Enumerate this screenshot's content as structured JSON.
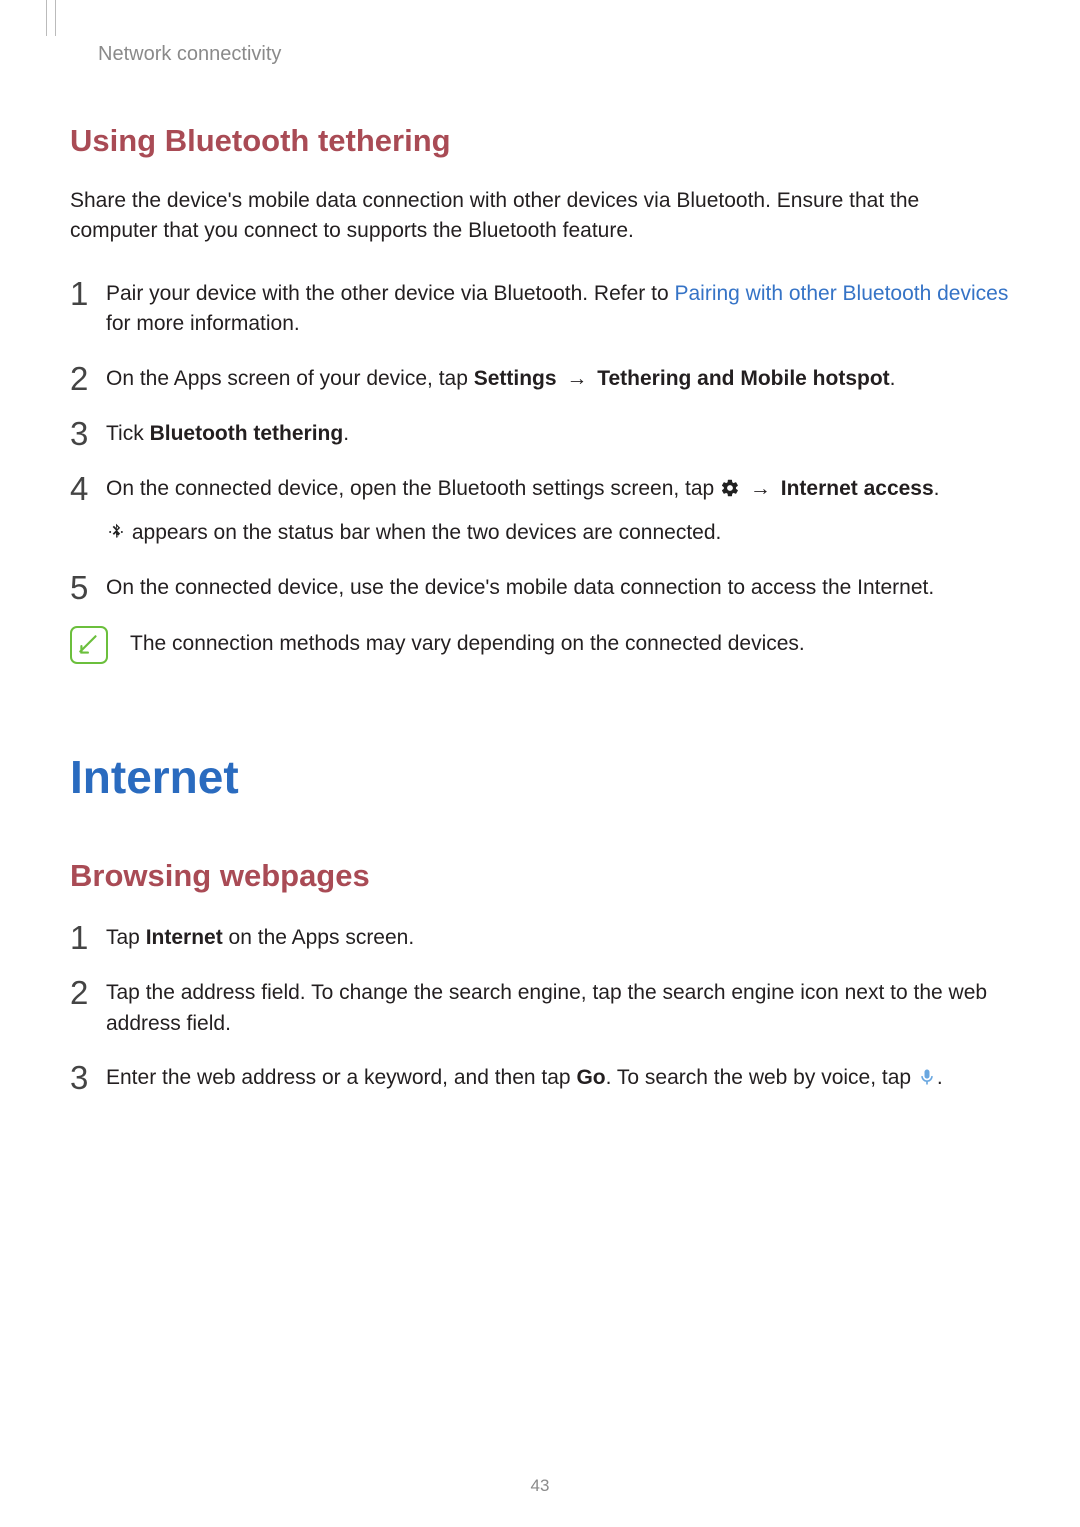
{
  "breadcrumb": "Network connectivity",
  "page_number": "43",
  "section1": {
    "heading": "Using Bluetooth tethering",
    "intro": "Share the device's mobile data connection with other devices via Bluetooth. Ensure that the computer that you connect to supports the Bluetooth feature.",
    "steps": {
      "s1": {
        "num": "1",
        "t1": "Pair your device with the other device via Bluetooth. Refer to ",
        "link": "Pairing with other Bluetooth devices",
        "t2": " for more information."
      },
      "s2": {
        "num": "2",
        "t1": "On the Apps screen of your device, tap ",
        "b1": "Settings",
        "arrow": " → ",
        "b2": "Tethering and Mobile hotspot",
        "t2": "."
      },
      "s3": {
        "num": "3",
        "t1": "Tick ",
        "b1": "Bluetooth tethering",
        "t2": "."
      },
      "s4": {
        "num": "4",
        "t1": "On the connected device, open the Bluetooth settings screen, tap ",
        "arrow": " → ",
        "b1": "Internet access",
        "t2": ".",
        "sub1": " appears on the status bar when the two devices are connected."
      },
      "s5": {
        "num": "5",
        "t1": "On the connected device, use the device's mobile data connection to access the Internet."
      }
    },
    "note": "The connection methods may vary depending on the connected devices."
  },
  "section2": {
    "heading": "Internet",
    "sub_heading": "Browsing webpages",
    "steps": {
      "s1": {
        "num": "1",
        "t1": "Tap ",
        "b1": "Internet",
        "t2": " on the Apps screen."
      },
      "s2": {
        "num": "2",
        "t1": "Tap the address field. To change the search engine, tap the search engine icon next to the web address field."
      },
      "s3": {
        "num": "3",
        "t1": "Enter the web address or a keyword, and then tap ",
        "b1": "Go",
        "t2": ". To search the web by voice, tap ",
        "t3": "."
      }
    }
  }
}
